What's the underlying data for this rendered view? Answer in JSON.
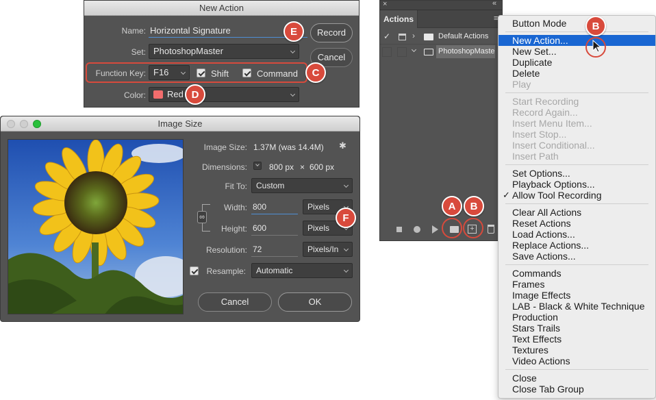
{
  "new_action": {
    "title": "New Action",
    "name_label": "Name:",
    "name_value": "Horizontal Signature",
    "set_label": "Set:",
    "set_value": "PhotoshopMaster",
    "function_key_label": "Function Key:",
    "function_key_value": "F16",
    "shift_label": "Shift",
    "command_label": "Command",
    "color_label": "Color:",
    "color_value": "Red",
    "color_swatch": "#f26d6d",
    "record_label": "Record",
    "cancel_label": "Cancel"
  },
  "image_size": {
    "title": "Image Size",
    "image_size_label": "Image Size:",
    "image_size_value": "1.37M (was 14.4M)",
    "dimensions_label": "Dimensions:",
    "dim_w": "800 px",
    "dim_x": "×",
    "dim_h": "600 px",
    "fit_to_label": "Fit To:",
    "fit_to_value": "Custom",
    "width_label": "Width:",
    "width_value": "800",
    "width_unit": "Pixels",
    "height_label": "Height:",
    "height_value": "600",
    "height_unit": "Pixels",
    "resolution_label": "Resolution:",
    "resolution_value": "72",
    "resolution_unit": "Pixels/In",
    "resample_label": "Resample:",
    "resample_value": "Automatic",
    "cancel_label": "Cancel",
    "ok_label": "OK"
  },
  "actions_panel": {
    "tab_label": "Actions",
    "rows": [
      {
        "name": "Default Actions"
      },
      {
        "name": "PhotoshopMaste"
      }
    ]
  },
  "flyout_menu": {
    "groups": [
      [
        {
          "label": "Button Mode",
          "disabled": false
        }
      ],
      [
        {
          "label": "New Action...",
          "disabled": false,
          "highlighted": true
        },
        {
          "label": "New Set...",
          "disabled": false
        },
        {
          "label": "Duplicate",
          "disabled": false
        },
        {
          "label": "Delete",
          "disabled": false
        },
        {
          "label": "Play",
          "disabled": true
        }
      ],
      [
        {
          "label": "Start Recording",
          "disabled": true
        },
        {
          "label": "Record Again...",
          "disabled": true
        },
        {
          "label": "Insert Menu Item...",
          "disabled": true
        },
        {
          "label": "Insert Stop...",
          "disabled": true
        },
        {
          "label": "Insert Conditional...",
          "disabled": true
        },
        {
          "label": "Insert Path",
          "disabled": true
        }
      ],
      [
        {
          "label": "Set Options...",
          "disabled": false
        },
        {
          "label": "Playback Options...",
          "disabled": false
        },
        {
          "label": "Allow Tool Recording",
          "disabled": false,
          "checked": true
        }
      ],
      [
        {
          "label": "Clear All Actions",
          "disabled": false
        },
        {
          "label": "Reset Actions",
          "disabled": false
        },
        {
          "label": "Load Actions...",
          "disabled": false
        },
        {
          "label": "Replace Actions...",
          "disabled": false
        },
        {
          "label": "Save Actions...",
          "disabled": false
        }
      ],
      [
        {
          "label": "Commands",
          "disabled": false
        },
        {
          "label": "Frames",
          "disabled": false
        },
        {
          "label": "Image Effects",
          "disabled": false
        },
        {
          "label": "LAB - Black & White Technique",
          "disabled": false
        },
        {
          "label": "Production",
          "disabled": false
        },
        {
          "label": "Stars Trails",
          "disabled": false
        },
        {
          "label": "Text Effects",
          "disabled": false
        },
        {
          "label": "Textures",
          "disabled": false
        },
        {
          "label": "Video Actions",
          "disabled": false
        }
      ],
      [
        {
          "label": "Close",
          "disabled": false
        },
        {
          "label": "Close Tab Group",
          "disabled": false
        }
      ]
    ]
  },
  "callouts": {
    "a": "A",
    "b": "B",
    "c": "C",
    "d": "D",
    "e": "E",
    "f": "F"
  },
  "colors": {
    "callout": "#d84a3c",
    "menu_highlight": "#1966d2",
    "dialog_bg": "#535353"
  }
}
